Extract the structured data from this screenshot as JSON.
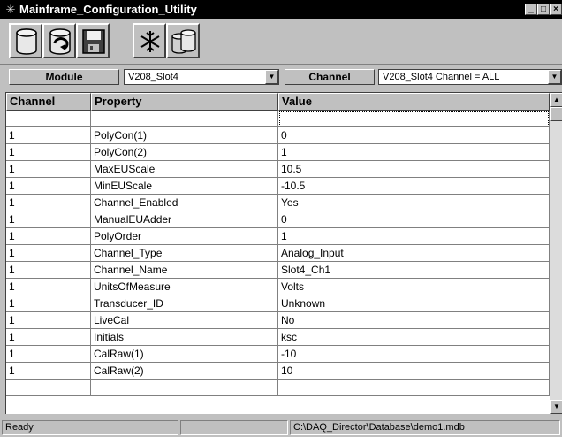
{
  "window": {
    "title": "Mainframe_Configuration_Utility",
    "minimize": "_",
    "maximize": "□",
    "close": "×"
  },
  "toolbar": {
    "buttons": [
      "database-icon",
      "database-refresh-icon",
      "save-icon",
      "snowflake-icon",
      "databases-icon"
    ]
  },
  "selectors": {
    "module_label": "Module",
    "module_value": "V208_Slot4",
    "channel_label": "Channel",
    "channel_value": "V208_Slot4  Channel = ALL"
  },
  "grid": {
    "headers": [
      "Channel",
      "Property",
      "Value"
    ],
    "rows": [
      [
        "",
        "",
        ""
      ],
      [
        "1",
        "PolyCon(1)",
        "0"
      ],
      [
        "1",
        "PolyCon(2)",
        "1"
      ],
      [
        "1",
        "MaxEUScale",
        "10.5"
      ],
      [
        "1",
        "MinEUScale",
        "-10.5"
      ],
      [
        "1",
        "Channel_Enabled",
        "Yes"
      ],
      [
        "1",
        "ManualEUAdder",
        "0"
      ],
      [
        "1",
        "PolyOrder",
        "1"
      ],
      [
        "1",
        "Channel_Type",
        "Analog_Input"
      ],
      [
        "1",
        "Channel_Name",
        "Slot4_Ch1"
      ],
      [
        "1",
        "UnitsOfMeasure",
        "Volts"
      ],
      [
        "1",
        "Transducer_ID",
        "Unknown"
      ],
      [
        "1",
        "LiveCal",
        "No"
      ],
      [
        "1",
        "Initials",
        "ksc"
      ],
      [
        "1",
        "CalRaw(1)",
        "-10"
      ],
      [
        "1",
        "CalRaw(2)",
        "10"
      ],
      [
        "",
        "",
        ""
      ]
    ]
  },
  "status": {
    "left": "Ready",
    "middle": "",
    "right": "C:\\DAQ_Director\\Database\\demo1.mdb"
  }
}
